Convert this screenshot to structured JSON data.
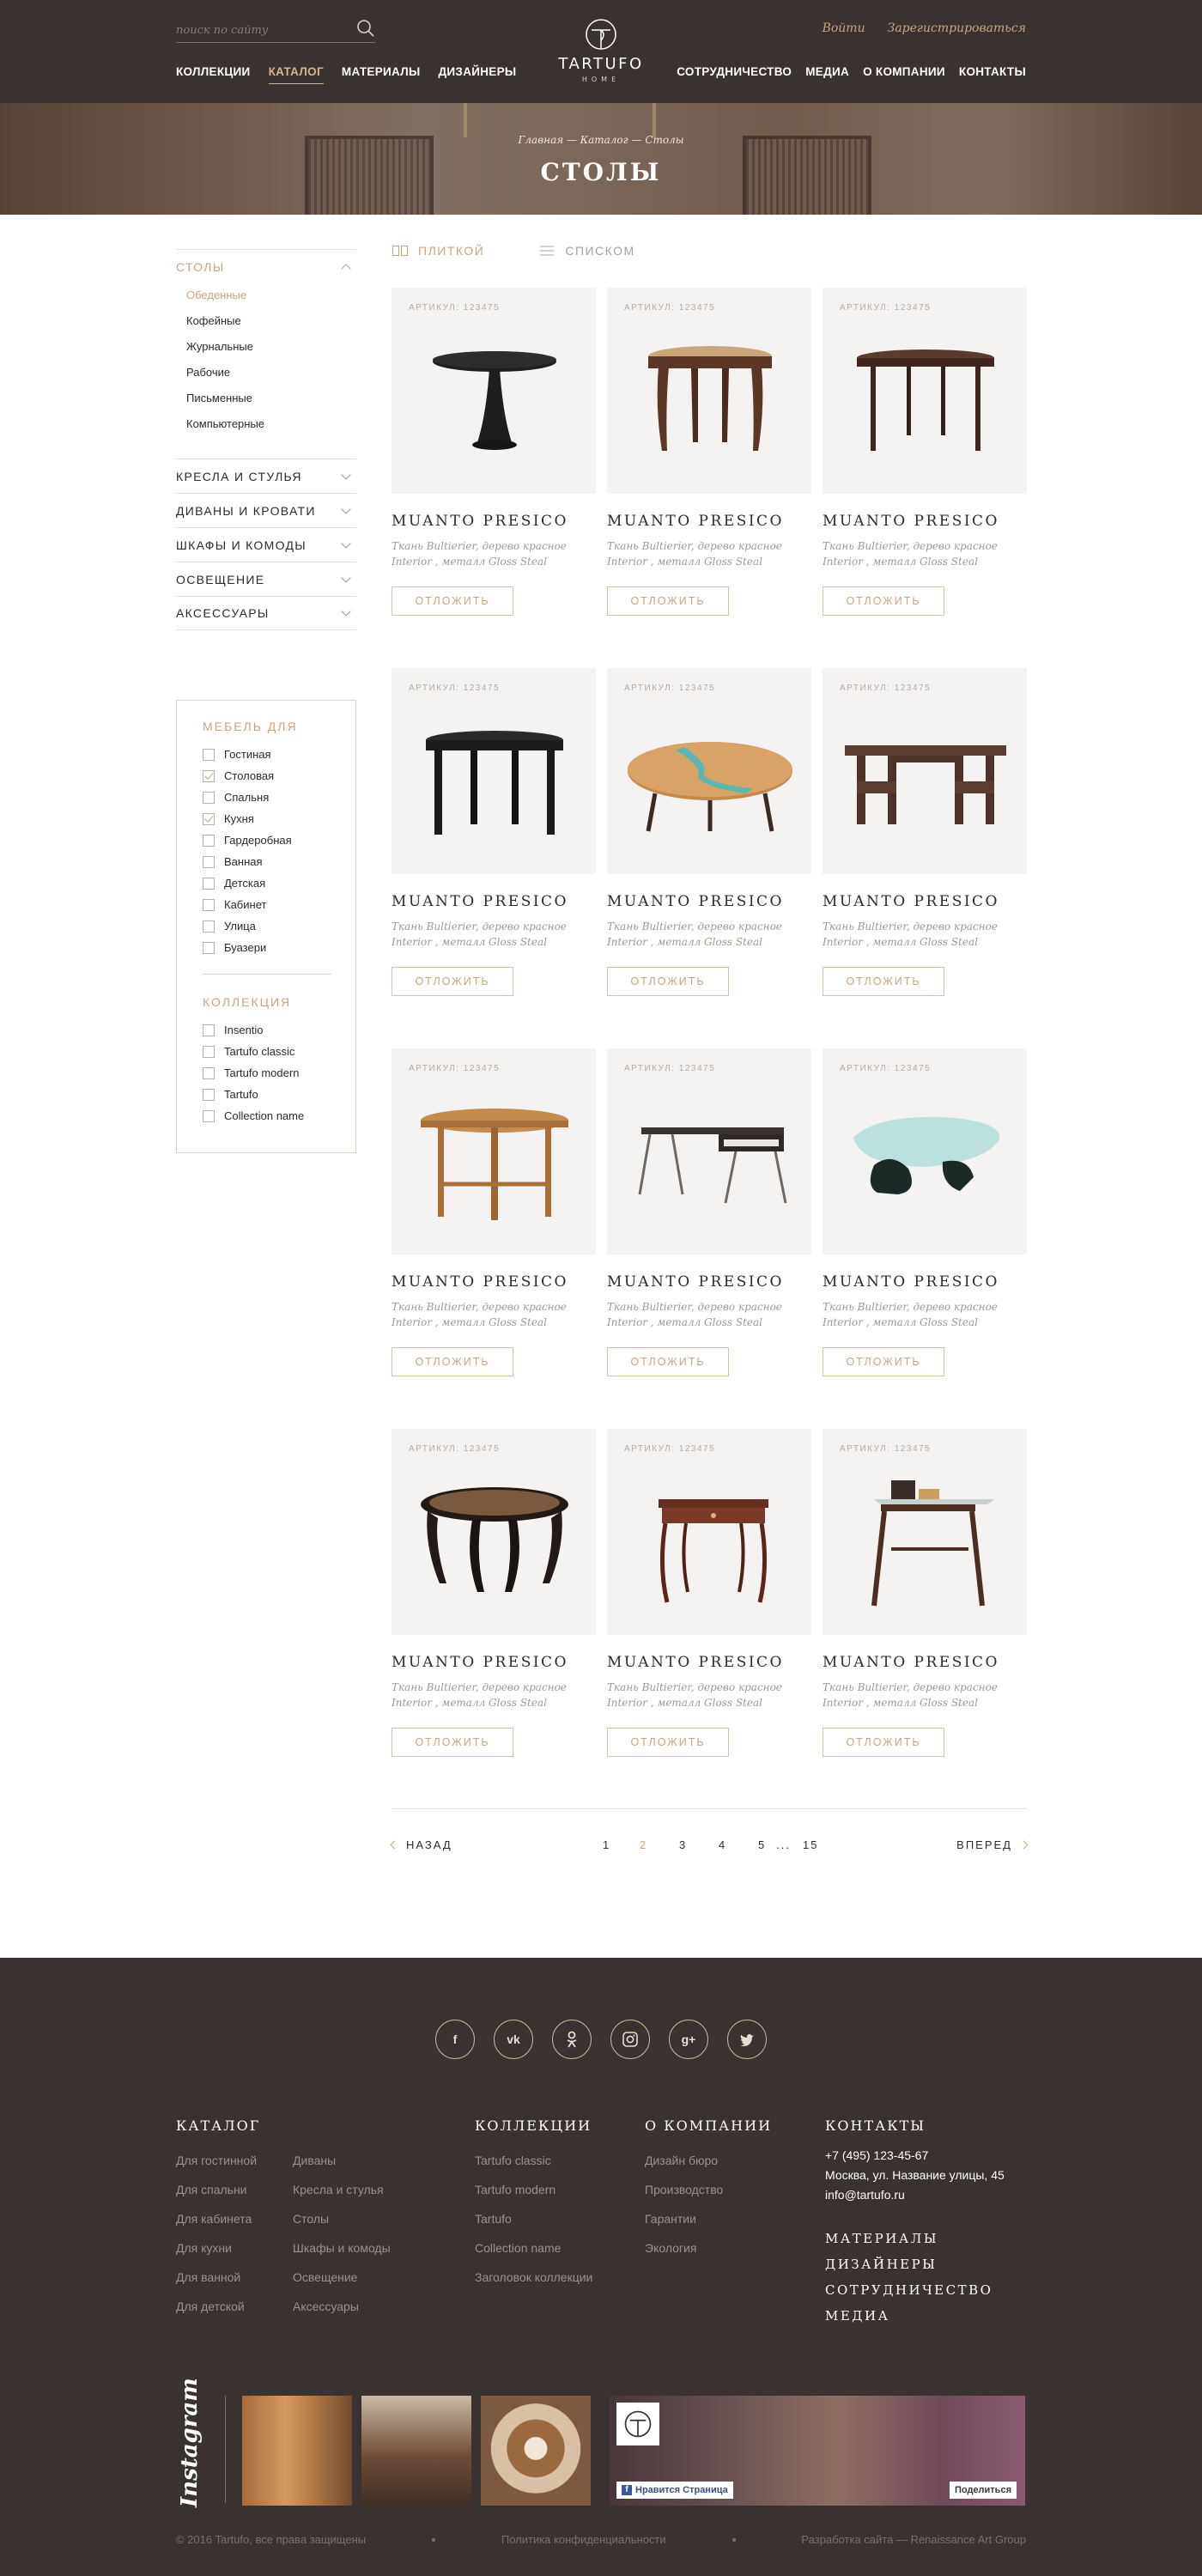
{
  "header": {
    "search_placeholder": "поиск по сайту",
    "auth": {
      "login": "Войти",
      "register": "Зарегистрироваться"
    },
    "nav_left": [
      {
        "label": "КОЛЛЕКЦИИ",
        "active": false
      },
      {
        "label": "КАТАЛОГ",
        "active": true
      },
      {
        "label": "МАТЕРИАЛЫ",
        "active": false
      },
      {
        "label": "ДИЗАЙНЕРЫ",
        "active": false
      }
    ],
    "nav_right": [
      "СОТРУДНИЧЕСТВО",
      "МЕДИА",
      "О КОМПАНИИ",
      "КОНТАКТЫ"
    ],
    "logo": {
      "name": "TARTUFO",
      "sub": "HOME"
    }
  },
  "hero": {
    "breadcrumb": "Главная — Каталог — Столы",
    "title": "СТОЛЫ"
  },
  "sidebar": {
    "categories": [
      {
        "label": "СТОЛЫ",
        "open": true,
        "subitems": [
          {
            "label": "Обеденные",
            "active": true
          },
          {
            "label": "Кофейные",
            "active": false
          },
          {
            "label": "Журнальные",
            "active": false
          },
          {
            "label": "Рабочие",
            "active": false
          },
          {
            "label": "Письменные",
            "active": false
          },
          {
            "label": "Компьютерные",
            "active": false
          }
        ]
      },
      {
        "label": "КРЕСЛА И СТУЛЬЯ",
        "open": false
      },
      {
        "label": "ДИВАНЫ И  КРОВАТИ",
        "open": false
      },
      {
        "label": "ШКАФЫ И КОМОДЫ",
        "open": false
      },
      {
        "label": "ОСВЕЩЕНИЕ",
        "open": false
      },
      {
        "label": "АКСЕССУАРЫ",
        "open": false
      }
    ],
    "filter": {
      "furniture_title": "МЕБЕЛЬ ДЛЯ",
      "furniture": [
        {
          "label": "Гостиная",
          "checked": false
        },
        {
          "label": "Столовая",
          "checked": true
        },
        {
          "label": "Спальня",
          "checked": false
        },
        {
          "label": "Кухня",
          "checked": true
        },
        {
          "label": "Гардеробная",
          "checked": false
        },
        {
          "label": "Ванная",
          "checked": false
        },
        {
          "label": "Детская",
          "checked": false
        },
        {
          "label": "Кабинет",
          "checked": false
        },
        {
          "label": "Улица",
          "checked": false
        },
        {
          "label": "Буазери",
          "checked": false
        }
      ],
      "collection_title": "КОЛЛЕКЦИЯ",
      "collections": [
        {
          "label": "Insentio",
          "checked": false
        },
        {
          "label": "Tartufo classic",
          "checked": false
        },
        {
          "label": "Tartufo modern",
          "checked": false
        },
        {
          "label": "Tartufo",
          "checked": false
        },
        {
          "label": "Collection name",
          "checked": false
        }
      ]
    }
  },
  "view_toggle": {
    "tiles": "ПЛИТКОЙ",
    "list": "СПИСКОМ",
    "active": "tiles"
  },
  "products": [
    {
      "sku": "АРТИКУЛ: 123475",
      "name": "MUANTO PRESICO",
      "desc_1": "Ткань Bultierier, дерево красное",
      "desc_2": "Interior , металл Gloss Steal",
      "button": "ОТЛОЖИТЬ",
      "image": "black-tulip-table"
    },
    {
      "sku": "АРТИКУЛ: 123475",
      "name": "MUANTO PRESICO",
      "desc_1": "Ткань Bultierier, дерево красное",
      "desc_2": "Interior , металл Gloss Steal",
      "button": "ОТЛОЖИТЬ",
      "image": "round-wood-table"
    },
    {
      "sku": "АРТИКУЛ: 123475",
      "name": "MUANTO PRESICO",
      "desc_1": "Ткань Bultierier, дерево красное",
      "desc_2": "Interior , металл Gloss Steal",
      "button": "ОТЛОЖИТЬ",
      "image": "dark-round-table"
    },
    {
      "sku": "АРТИКУЛ: 123475",
      "name": "MUANTO PRESICO",
      "desc_1": "Ткань Bultierier, дерево красное",
      "desc_2": "Interior , металл Gloss Steal",
      "button": "ОТЛОЖИТЬ",
      "image": "black-round-table"
    },
    {
      "sku": "АРТИКУЛ: 123475",
      "name": "MUANTO PRESICO",
      "desc_1": "Ткань Bultierier, дерево красное",
      "desc_2": "Interior , металл Gloss Steal",
      "button": "ОТЛОЖИТЬ",
      "image": "river-coffee-table"
    },
    {
      "sku": "АРТИКУЛ: 123475",
      "name": "MUANTO PRESICO",
      "desc_1": "Ткань Bultierier, дерево красное",
      "desc_2": "Interior , металл Gloss Steal",
      "button": "ОТЛОЖИТЬ",
      "image": "trestle-table"
    },
    {
      "sku": "АРТИКУЛ: 123475",
      "name": "MUANTO PRESICO",
      "desc_1": "Ткань Bultierier, дерево красное",
      "desc_2": "Interior , металл Gloss Steal",
      "button": "ОТЛОЖИТЬ",
      "image": "oak-dining-table"
    },
    {
      "sku": "АРТИКУЛ: 123475",
      "name": "MUANTO PRESICO",
      "desc_1": "Ткань Bultierier, дерево красное",
      "desc_2": "Interior , металл Gloss Steal",
      "button": "ОТЛОЖИТЬ",
      "image": "writing-desk"
    },
    {
      "sku": "АРТИКУЛ: 123475",
      "name": "MUANTO PRESICO",
      "desc_1": "Ткань Bultierier, дерево красное",
      "desc_2": "Interior , металл Gloss Steal",
      "button": "ОТЛОЖИТЬ",
      "image": "glass-coffee-table"
    },
    {
      "sku": "АРТИКУЛ: 123475",
      "name": "MUANTO PRESICO",
      "desc_1": "Ткань Bultierier, дерево красное",
      "desc_2": "Interior , металл Gloss Steal",
      "button": "ОТЛОЖИТЬ",
      "image": "carved-round-table"
    },
    {
      "sku": "АРТИКУЛ: 123475",
      "name": "MUANTO PRESICO",
      "desc_1": "Ткань Bultierier, дерево красное",
      "desc_2": "Interior , металл Gloss Steal",
      "button": "ОТЛОЖИТЬ",
      "image": "console-table"
    },
    {
      "sku": "АРТИКУЛ: 123475",
      "name": "MUANTO PRESICO",
      "desc_1": "Ткань Bultierier, дерево красное",
      "desc_2": "Interior , металл Gloss Steal",
      "button": "ОТЛОЖИТЬ",
      "image": "wood-glass-desk"
    }
  ],
  "pagination": {
    "prev": "НАЗАД",
    "next": "ВПЕРЕД",
    "pages": [
      "1",
      "2",
      "3",
      "4",
      "5",
      "...",
      "15"
    ],
    "current": "2"
  },
  "footer": {
    "social": [
      "facebook-icon",
      "vk-icon",
      "odnoklassniki-icon",
      "instagram-icon",
      "google-plus-icon",
      "twitter-icon"
    ],
    "catalog_title": "КАТАЛОГ",
    "catalog_col1": [
      "Для гостинной",
      "Для спальни",
      "Для кабинета",
      "Для кухни",
      "Для ванной",
      "Для детской"
    ],
    "catalog_col2": [
      "Диваны",
      "Кресла и стулья",
      "Столы",
      "Шкафы и комоды",
      "Освещение",
      "Аксессуары"
    ],
    "collections_title": "КОЛЛЕКЦИИ",
    "collections": [
      "Tartufo classic",
      "Tartufo modern",
      "Tartufo",
      "Collection name",
      "Заголовок коллекции"
    ],
    "company_title": "О КОМПАНИИ",
    "company": [
      "Дизайн бюро",
      "Производство",
      "Гарантии",
      "Экология"
    ],
    "contacts_title": "КОНТАКТЫ",
    "phone": "+7 (495) 123-45-67",
    "address": "Москва, ул. Название улицы, 45",
    "email": "info@tartufo.ru",
    "big_links": [
      "МАТЕРИАЛЫ",
      "ДИЗАЙНЕРЫ",
      "СОТРУДНИЧЕСТВО",
      "МЕДИА"
    ],
    "instagram": "Instagram",
    "fb_like": "Нравится Страница",
    "fb_share": "Поделиться",
    "copyright": "© 2016 Tartufo, все права защищены",
    "privacy": "Политика конфиденциальности",
    "dev": "Разработка сайта — Renaissance Art Group"
  },
  "colors": {
    "accent": "#c9a57e",
    "header_bg": "#3a3231",
    "card_bg": "#f4f3f2"
  }
}
